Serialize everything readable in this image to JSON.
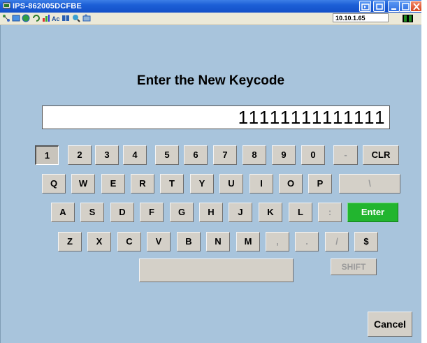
{
  "window": {
    "title": "IPS-862005DCFBE",
    "ip_address": "10.10.1.65"
  },
  "toolbar": {
    "icons": [
      "network-icon",
      "window-icon",
      "globe-icon",
      "refresh-icon",
      "chart-icon",
      "font-icon",
      "book-icon",
      "world-search-icon",
      "settings-icon"
    ]
  },
  "page": {
    "title": "Enter the New Keycode",
    "keycode_value": "11111111111111"
  },
  "keyboard": {
    "row1": [
      "1",
      "2",
      "3",
      "4",
      "5",
      "6",
      "7",
      "8",
      "9",
      "0",
      "-",
      "CLR"
    ],
    "row2": [
      "Q",
      "W",
      "E",
      "R",
      "T",
      "Y",
      "U",
      "I",
      "O",
      "P",
      "\\"
    ],
    "row3": [
      "A",
      "S",
      "D",
      "F",
      "G",
      "H",
      "J",
      "K",
      "L",
      ":",
      "Enter"
    ],
    "row4": [
      "Z",
      "X",
      "C",
      "V",
      "B",
      "N",
      "M",
      ",",
      ".",
      "/",
      "$"
    ],
    "space_label": "",
    "shift_label": "SHIFT"
  },
  "cancel_label": "Cancel",
  "colors": {
    "titlebar": "#1c5fd6",
    "panel": "#a8c4dc",
    "key": "#d4d0c8",
    "enter": "#22b52f"
  }
}
